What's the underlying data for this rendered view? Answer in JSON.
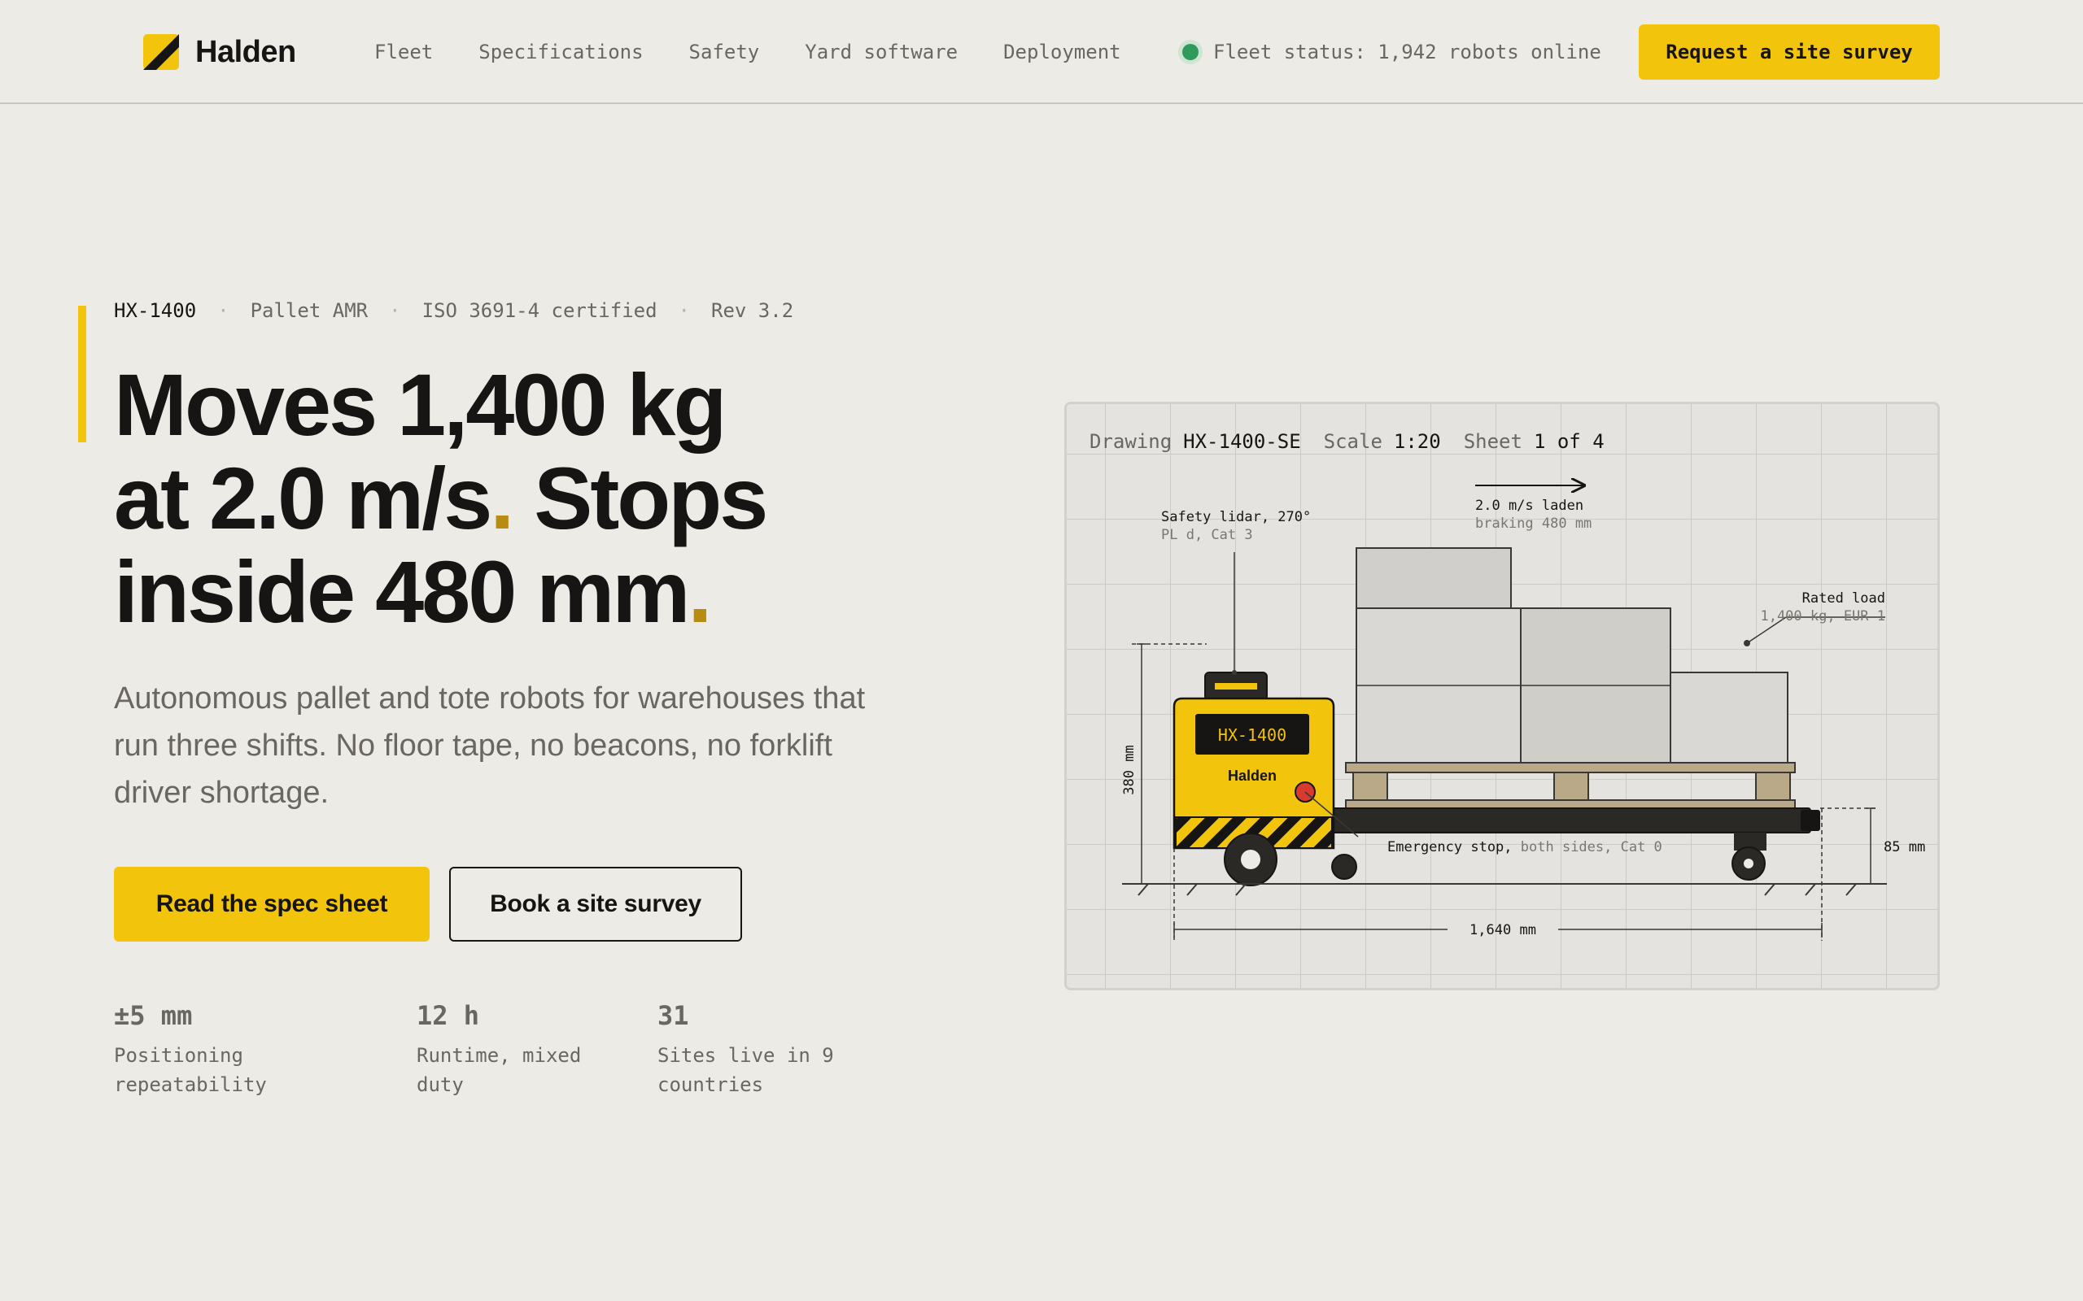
{
  "brand": {
    "name": "Halden",
    "colors": {
      "accent": "#f2c40b",
      "ink": "#161513",
      "muted": "#6a6762",
      "status_ok": "#2f9b5a"
    }
  },
  "nav": {
    "items": [
      "Fleet",
      "Specifications",
      "Safety",
      "Yard software",
      "Deployment"
    ]
  },
  "status": {
    "text": "Fleet status: 1,942 robots online"
  },
  "header_cta": "Request a site survey",
  "hero": {
    "meta": {
      "model": "HX-1400",
      "type": "Pallet AMR",
      "cert": "ISO 3691-4 certified",
      "rev": "Rev 3.2"
    },
    "headline": {
      "line1": "Moves 1,400 kg",
      "line2a": "at 2.0 m/s",
      "dot": ".",
      "line2b": " Stops",
      "line3": "inside 480 mm"
    },
    "subcopy": "Autonomous pallet and tote robots for warehouses that run three shifts. No floor tape, no beacons, no forklift driver shortage.",
    "cta_primary": "Read the spec sheet",
    "cta_secondary": "Book a site survey",
    "stats": [
      {
        "value": "±5 mm",
        "label": "Positioning repeatability"
      },
      {
        "value": "12 h",
        "label": "Runtime, mixed duty"
      },
      {
        "value": "31",
        "label": "Sites live in 9 countries"
      }
    ]
  },
  "drawing": {
    "drawing_label": "Drawing",
    "drawing_id": "HX-1400-SE",
    "scale_label": "Scale",
    "scale": "1:20",
    "sheet_label": "Sheet",
    "sheet": "1 of 4",
    "lidar": {
      "title": "Safety lidar, 270°",
      "sub": "PL d, Cat 3"
    },
    "speed": {
      "title": "2.0 m/s laden",
      "sub": "braking 480 mm"
    },
    "load": {
      "title": "Rated load",
      "sub": "1,400 kg, EUR 1"
    },
    "estop": {
      "title": "Emergency stop,",
      "sub": "both sides, Cat 0"
    },
    "body_label": "HX-1400",
    "body_brand": "Halden",
    "dim_height": "380 mm",
    "dim_length": "1,640 mm",
    "dim_clearance": "85 mm"
  }
}
